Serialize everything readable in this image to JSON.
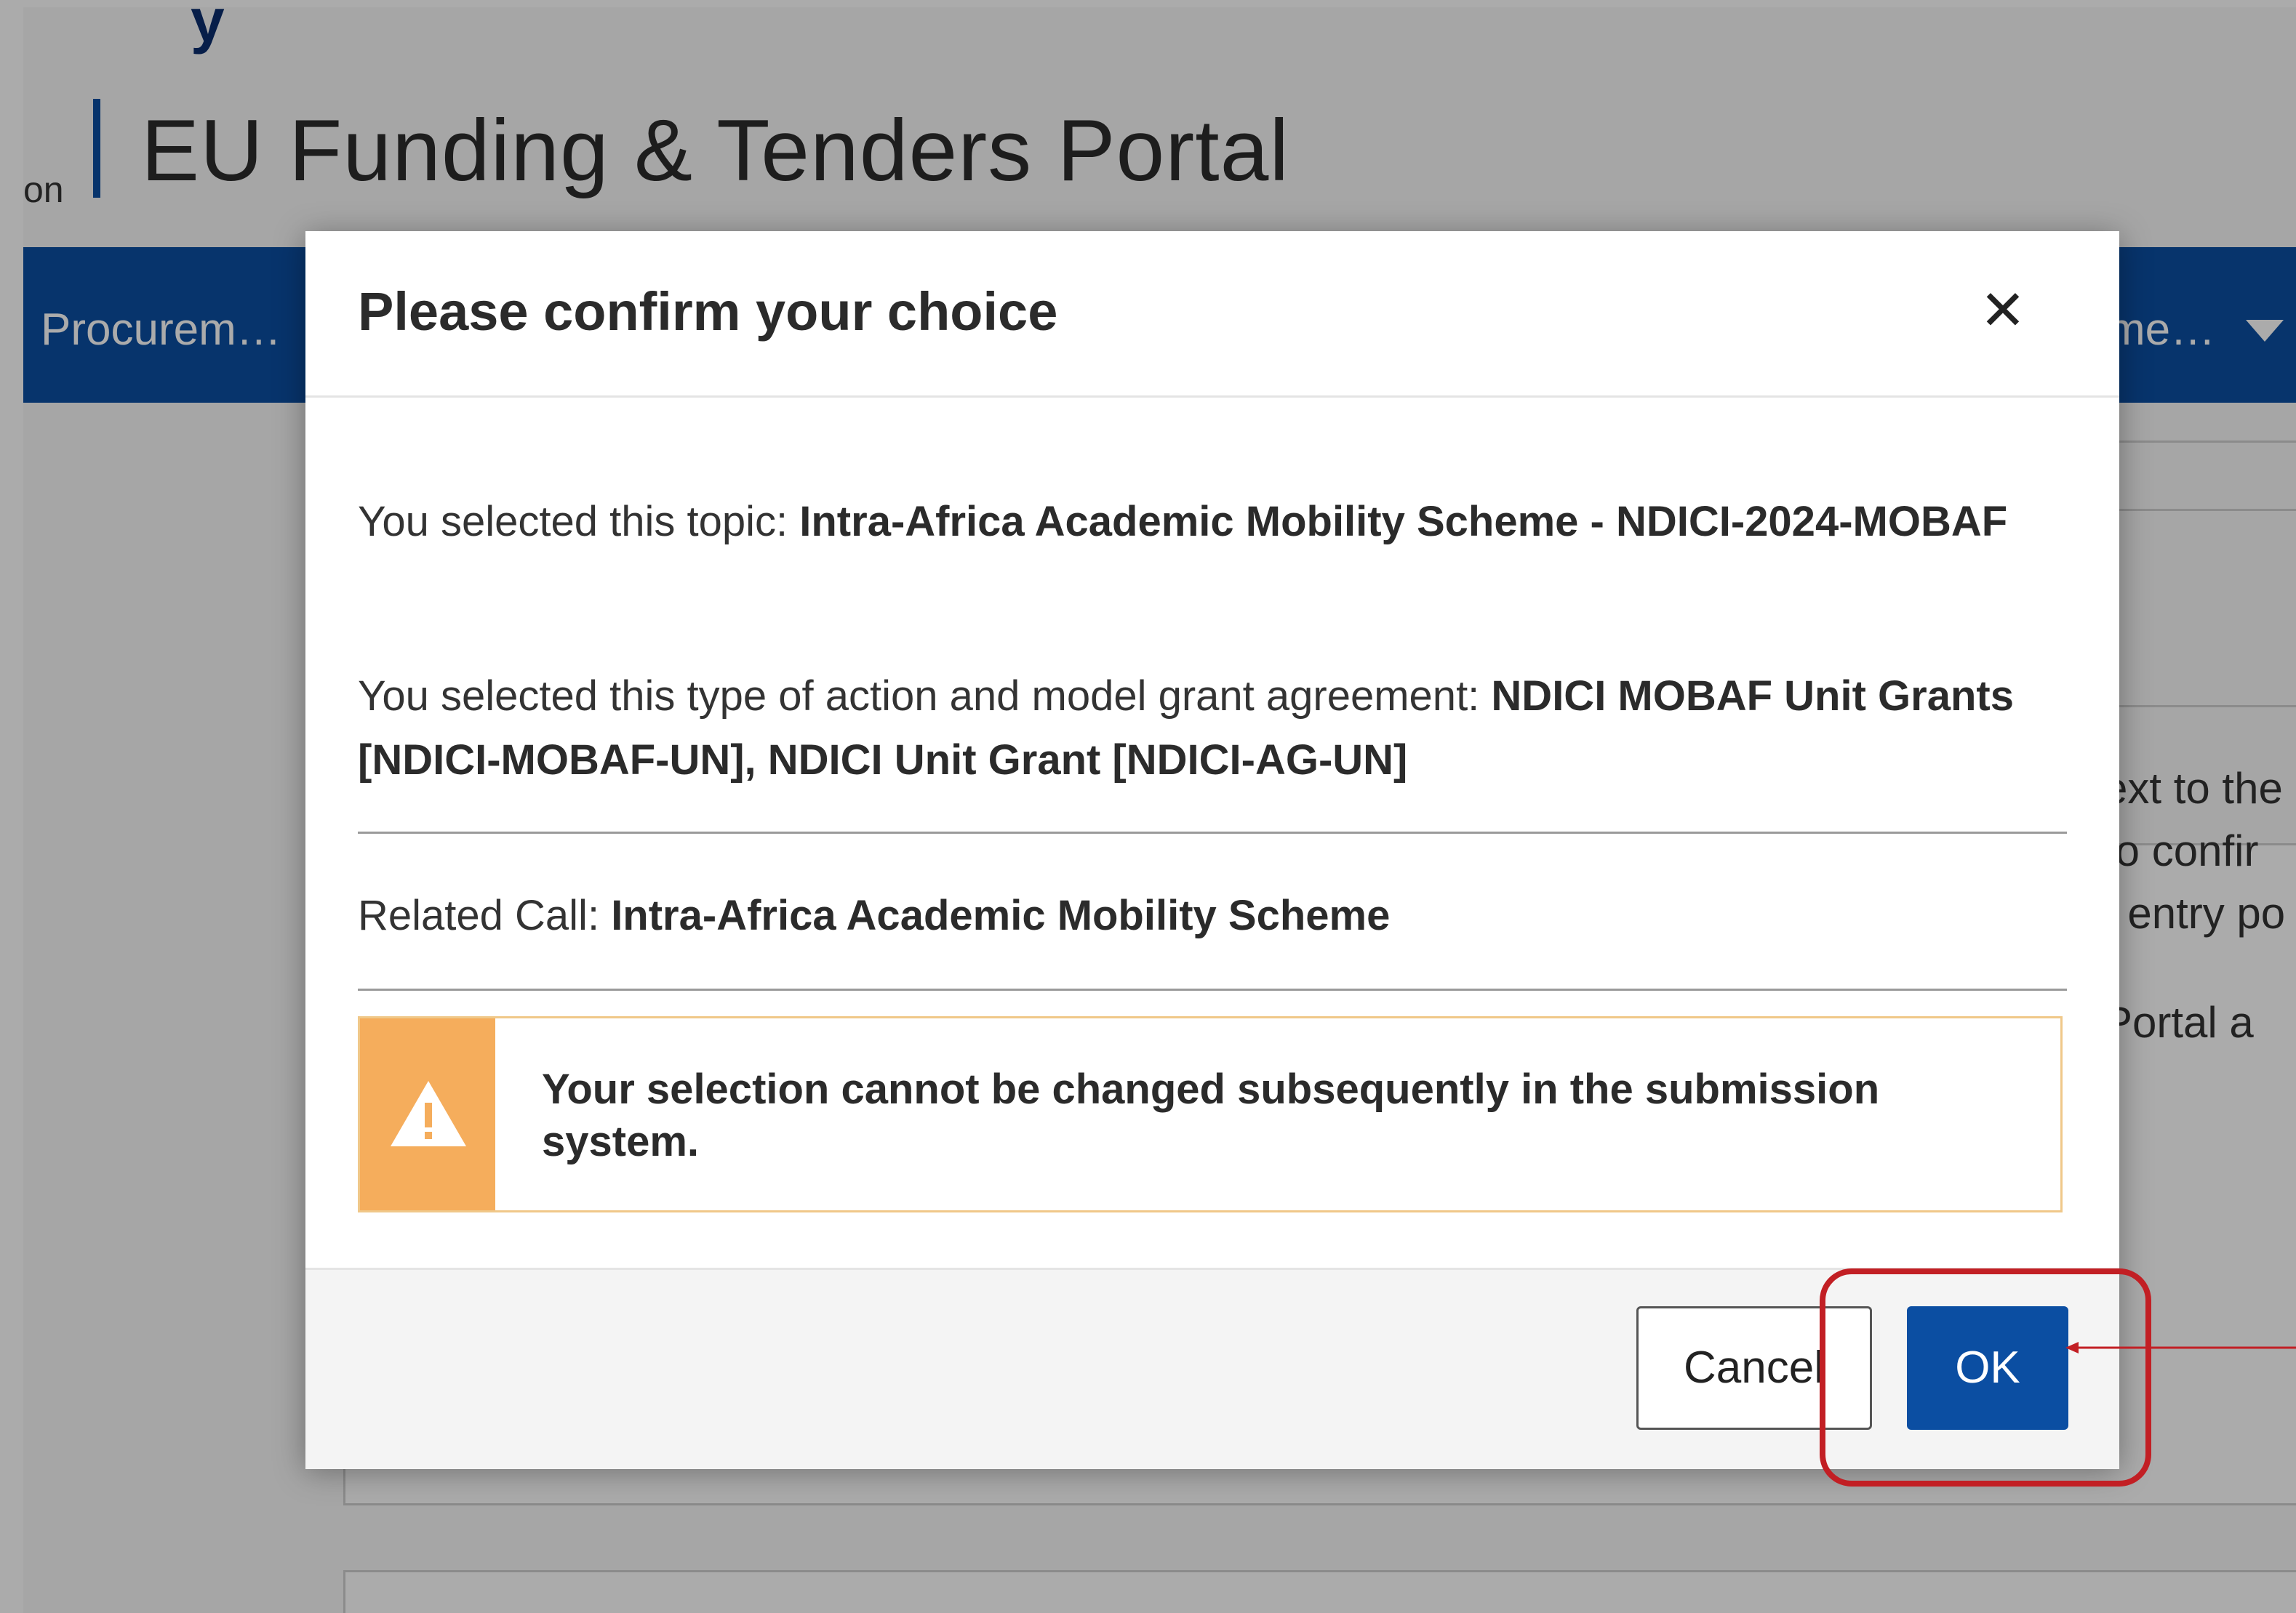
{
  "background": {
    "site_prefix": "on",
    "site_title": "EU Funding & Tenders Portal",
    "nav_left": "Procurem…",
    "nav_right": "me…",
    "side_text": [
      "ext to the",
      "to confir",
      "t entry po",
      "Portal a",
      "]"
    ]
  },
  "modal": {
    "title": "Please confirm your choice",
    "close_symbol": "✕",
    "topic": {
      "prefix": "You selected this topic:",
      "value": "Intra-Africa Academic Mobility Scheme - NDICI-2024-MOBAF"
    },
    "action_type": {
      "prefix": "You selected this type of action and model grant agreement:",
      "value": "NDICI MOBAF Unit Grants [NDICI-MOBAF-UN], NDICI Unit Grant [NDICI-AG-UN]"
    },
    "related_call": {
      "prefix": "Related Call:",
      "value": "Intra-Africa Academic Mobility Scheme"
    },
    "warning": {
      "icon": "warning-triangle-icon",
      "text": "Your selection cannot be changed subsequently in the submission system."
    },
    "buttons": {
      "cancel": "Cancel",
      "ok": "OK"
    }
  },
  "colors": {
    "brand_blue": "#0b4ea2",
    "warning_orange": "#f5ad5c",
    "annotation_red": "#c21f24"
  }
}
